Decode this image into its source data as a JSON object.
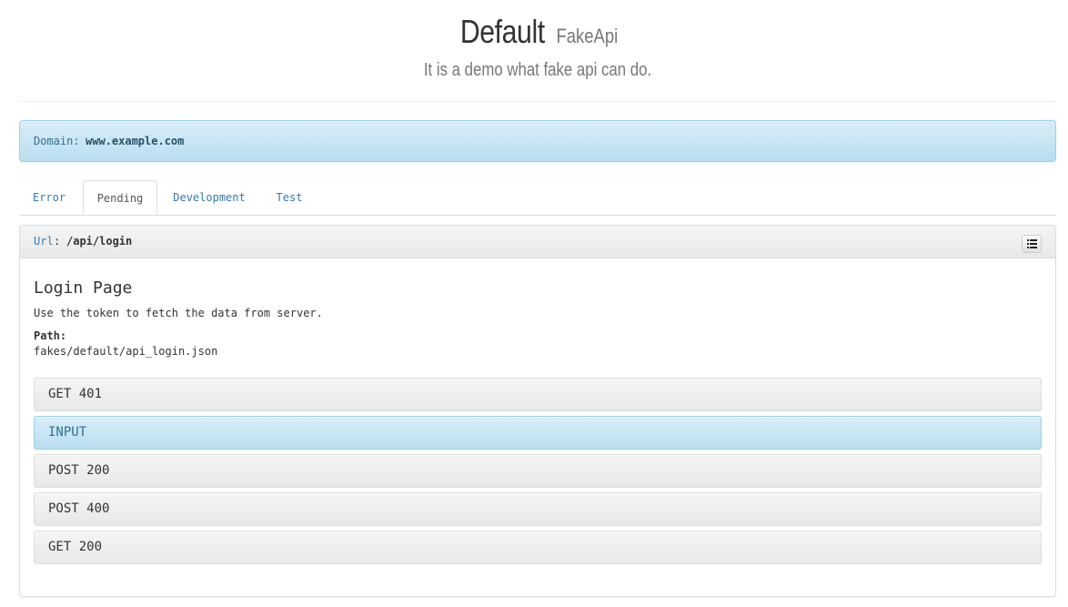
{
  "header": {
    "title": "Default",
    "title_small": "FakeApi",
    "subtitle": "It is a demo what fake api can do."
  },
  "domain": {
    "label": "Domain:",
    "value": "www.example.com"
  },
  "tabs": [
    {
      "label": "Error",
      "active": false
    },
    {
      "label": "Pending",
      "active": true
    },
    {
      "label": "Development",
      "active": false
    },
    {
      "label": "Test",
      "active": false
    }
  ],
  "panel": {
    "url_label": "Url",
    "url_separator": ":",
    "url_value": "/api/login",
    "list_icon": "list-icon",
    "title": "Login Page",
    "description": "Use the token to fetch the data from server.",
    "path_label": "Path:",
    "path_value": "fakes/default/api_login.json",
    "methods": [
      {
        "label": "GET 401",
        "highlight": false
      },
      {
        "label": "INPUT",
        "highlight": true
      },
      {
        "label": "POST 200",
        "highlight": false
      },
      {
        "label": "POST 400",
        "highlight": false
      },
      {
        "label": "GET 200",
        "highlight": false
      }
    ]
  },
  "colors": {
    "link": "#337ab7",
    "info_bg": "#d9edf7",
    "info_text": "#31708f",
    "border": "#dddddd"
  }
}
